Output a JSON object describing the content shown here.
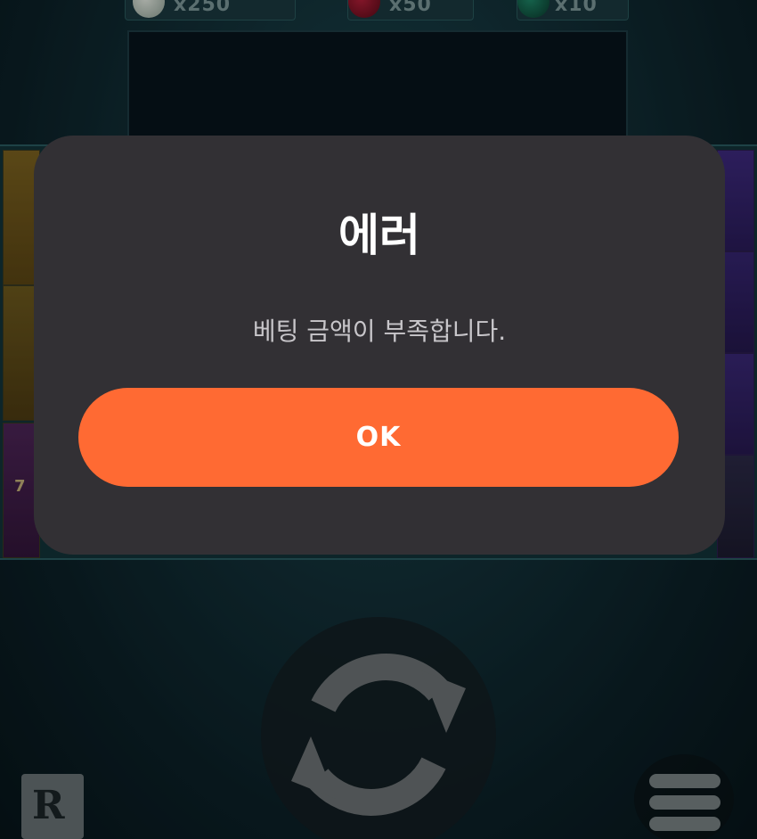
{
  "background": {
    "counters": [
      {
        "gem_color": "#dfe6dc",
        "multiplier": "x250"
      },
      {
        "gem_color": "#b8203a",
        "multiplier": "x50"
      },
      {
        "gem_color": "#1f8a6a",
        "multiplier": "x10"
      }
    ],
    "reel_number": "7",
    "logo_text": "R"
  },
  "dialog": {
    "title": "에러",
    "message": "베팅 금액이 부족합니다.",
    "ok_label": "OK"
  },
  "colors": {
    "dialog_bg": "#323034",
    "ok_button": "#ff6a33",
    "title": "#ffffff",
    "message": "#c8c6ca"
  },
  "icons": {
    "spin": "refresh-arrows-icon",
    "menu": "hamburger-menu-icon"
  }
}
